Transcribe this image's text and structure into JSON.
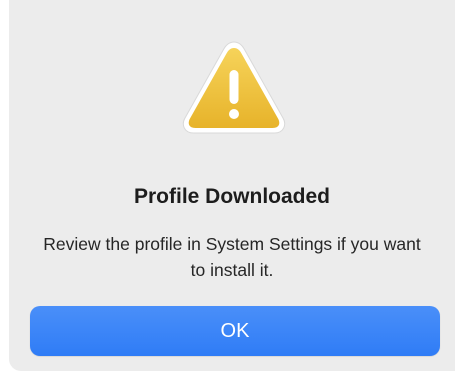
{
  "dialog": {
    "icon": "warning-triangle-icon",
    "title": "Profile Downloaded",
    "message": "Review the profile in System Settings if you want to install it.",
    "ok_label": "OK"
  },
  "colors": {
    "background": "#ececec",
    "warning_yellow": "#f1c232",
    "button_blue": "#357ff6",
    "button_text": "#ffffff"
  }
}
